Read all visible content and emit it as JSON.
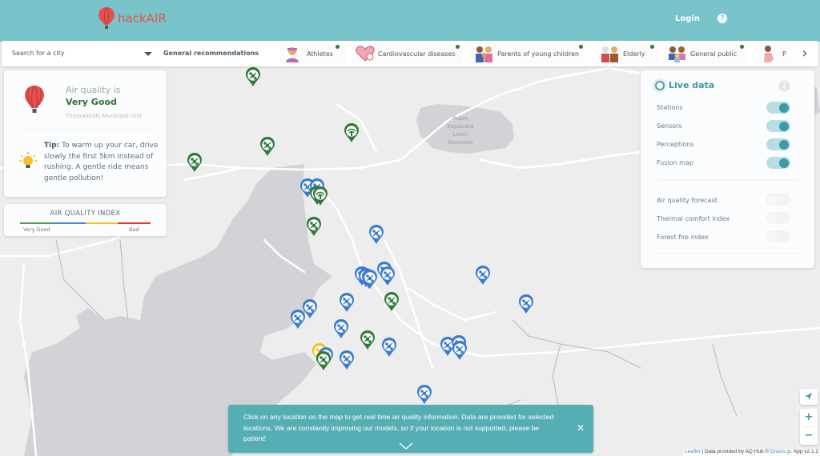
{
  "header": {
    "brand": "hackAIR",
    "login_label": "Login",
    "help_icon": "question-circle-icon",
    "color": "#78c4ca"
  },
  "toolbar": {
    "search_placeholder": "Search for a city",
    "general_recommendations": "General recommendations",
    "categories": [
      {
        "label": "Athletes",
        "icon": "athlete-icon",
        "has_dot": true
      },
      {
        "label": "Cardiovascular diseases",
        "icon": "heart-icon",
        "has_dot": true
      },
      {
        "label": "Parents of young children",
        "icon": "family-icon",
        "has_dot": true
      },
      {
        "label": "Elderly",
        "icon": "elderly-icon",
        "has_dot": true
      },
      {
        "label": "General public",
        "icon": "people-icon",
        "has_dot": true
      },
      {
        "label": "P",
        "icon": "pregnant-icon",
        "has_dot": false
      }
    ],
    "next_icon": "chevron-right-icon"
  },
  "air_quality": {
    "prefix": "Air quality is",
    "level": "Very Good",
    "location": "Thessaloniki Municipal Unit",
    "tip_label": "Tip:",
    "tip_text": " To warm up your car, drive slowly the first 5km instead of rushing. A gentle ride means gentle pollution!"
  },
  "aq_index": {
    "title": "AIR QUALITY INDEX",
    "low_label": "Very Good",
    "high_label": "Bad",
    "colors": [
      "#4f9a57",
      "#4a86d8",
      "#f2c12e",
      "#e23b2e"
    ]
  },
  "layers": {
    "title": "Live data",
    "live": [
      {
        "label": "Stations",
        "on": true
      },
      {
        "label": "Sensors",
        "on": true
      },
      {
        "label": "Perceptions",
        "on": true
      },
      {
        "label": "Fusion map",
        "on": true
      }
    ],
    "extra": [
      {
        "label": "Air quality forecast",
        "on": false
      },
      {
        "label": "Thermal comfort index",
        "on": false
      },
      {
        "label": "Forest fire index",
        "on": false
      }
    ]
  },
  "map": {
    "lake_label": [
      "Λιμνη",
      "Κορώνεια",
      "Limni",
      "Koroneia"
    ],
    "pin_colors": {
      "good": "#2f7a3a",
      "moderate": "#3b7bcf",
      "yellow": "#f0c419"
    },
    "pins": [
      {
        "status": "good",
        "type": "sensor"
      },
      {
        "status": "good",
        "type": "sensor"
      },
      {
        "status": "good",
        "type": "station"
      },
      {
        "status": "good",
        "type": "sensor"
      },
      {
        "status": "moderate",
        "type": "sensor"
      },
      {
        "status": "moderate",
        "type": "sensor"
      },
      {
        "status": "good",
        "type": "sensor"
      },
      {
        "status": "good",
        "type": "station"
      },
      {
        "status": "good",
        "type": "sensor"
      },
      {
        "status": "moderate",
        "type": "sensor"
      },
      {
        "status": "moderate",
        "type": "sensor"
      },
      {
        "status": "moderate",
        "type": "sensor"
      },
      {
        "status": "moderate",
        "type": "sensor"
      },
      {
        "status": "moderate",
        "type": "sensor"
      },
      {
        "status": "moderate",
        "type": "sensor"
      },
      {
        "status": "moderate",
        "type": "sensor"
      },
      {
        "status": "moderate",
        "type": "sensor"
      },
      {
        "status": "good",
        "type": "sensor"
      },
      {
        "status": "moderate",
        "type": "sensor"
      },
      {
        "status": "moderate",
        "type": "sensor"
      },
      {
        "status": "moderate",
        "type": "sensor"
      },
      {
        "status": "moderate",
        "type": "sensor"
      },
      {
        "status": "good",
        "type": "sensor"
      },
      {
        "status": "moderate",
        "type": "sensor"
      },
      {
        "status": "moderate",
        "type": "sensor"
      },
      {
        "status": "yellow",
        "type": "sensor"
      },
      {
        "status": "moderate",
        "type": "sensor"
      },
      {
        "status": "good",
        "type": "sensor"
      },
      {
        "status": "moderate",
        "type": "sensor"
      },
      {
        "status": "moderate",
        "type": "sensor"
      },
      {
        "status": "moderate",
        "type": "sensor"
      },
      {
        "status": "moderate",
        "type": "sensor"
      },
      {
        "status": "moderate",
        "type": "sensor"
      }
    ]
  },
  "notification": {
    "text": "Click on any location on the map to get real time air quality information. Data are provided for selected locations. We are constantly improving our models, so if your location is not supported, please be patient!",
    "close_icon": "close-icon"
  },
  "controls": {
    "zoom_in": "+",
    "zoom_out": "−",
    "locate_icon": "locate-arrow-icon"
  },
  "attribution": {
    "leaflet": "Leaflet",
    "mid": " | Data provided by AQ Hub © ",
    "draxis": "Draxis.gr",
    "version": ". App v2.1.2"
  }
}
